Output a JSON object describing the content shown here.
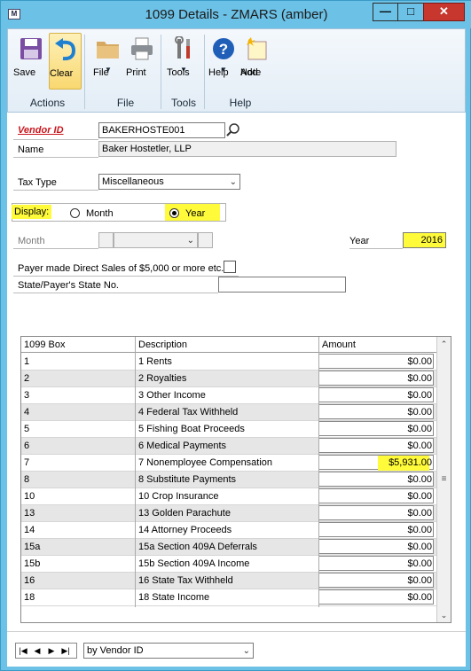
{
  "window": {
    "title": "1099 Details  -  ZMARS (amber)",
    "minimize": "—",
    "maximize": "□",
    "close": "✕"
  },
  "ribbon": {
    "groups": [
      {
        "name": "Actions",
        "items": [
          {
            "label": "Save",
            "icon": "save-icon"
          },
          {
            "label": "Clear",
            "icon": "undo-icon"
          }
        ]
      },
      {
        "name": "File",
        "items": [
          {
            "label": "File",
            "icon": "folder-icon"
          },
          {
            "label": "Print",
            "icon": "printer-icon"
          }
        ]
      },
      {
        "name": "Tools",
        "items": [
          {
            "label": "Tools",
            "icon": "tools-icon"
          }
        ]
      },
      {
        "name": "Help",
        "items": [
          {
            "label": "Help",
            "icon": "help-icon"
          },
          {
            "label": "Add\nNote",
            "icon": "note-icon"
          }
        ]
      }
    ],
    "save": "Save",
    "clear": "Clear",
    "file": "File",
    "print": "Print",
    "tools": "Tools",
    "help": "Help",
    "add": "Add",
    "note": "Note",
    "group_actions": "Actions",
    "group_file": "File",
    "group_tools": "Tools",
    "group_help": "Help"
  },
  "form": {
    "vendor_id_label": "Vendor ID",
    "vendor_id_value": "BAKERHOSTE001",
    "name_label": "Name",
    "name_value": "Baker Hostetler, LLP",
    "tax_type_label": "Tax Type",
    "tax_type_value": "Miscellaneous",
    "display_label": "Display:",
    "display_month": "Month",
    "display_year": "Year",
    "display_selected": "Year",
    "month_label": "Month",
    "year_label": "Year",
    "year_value": "2016",
    "direct_sales_label": "Payer made Direct Sales of $5,000 or more etc.",
    "direct_sales_checked": false,
    "state_label": "State/Payer's State No.",
    "state_value": ""
  },
  "grid": {
    "headers": [
      "1099 Box",
      "Description",
      "Amount"
    ],
    "rows": [
      {
        "box": "1",
        "description": "1 Rents",
        "amount": "$0.00"
      },
      {
        "box": "2",
        "description": "2 Royalties",
        "amount": "$0.00"
      },
      {
        "box": "3",
        "description": "3 Other Income",
        "amount": "$0.00"
      },
      {
        "box": "4",
        "description": "4 Federal Tax Withheld",
        "amount": "$0.00"
      },
      {
        "box": "5",
        "description": "5 Fishing Boat Proceeds",
        "amount": "$0.00"
      },
      {
        "box": "6",
        "description": "6 Medical Payments",
        "amount": "$0.00"
      },
      {
        "box": "7",
        "description": "7 Nonemployee Compensation",
        "amount": "$5,931.00"
      },
      {
        "box": "8",
        "description": "8 Substitute Payments",
        "amount": "$0.00"
      },
      {
        "box": "10",
        "description": "10 Crop Insurance",
        "amount": "$0.00"
      },
      {
        "box": "13",
        "description": "13 Golden Parachute",
        "amount": "$0.00"
      },
      {
        "box": "14",
        "description": "14 Attorney Proceeds",
        "amount": "$0.00"
      },
      {
        "box": "15a",
        "description": "15a Section 409A Deferrals",
        "amount": "$0.00"
      },
      {
        "box": "15b",
        "description": "15b Section 409A Income",
        "amount": "$0.00"
      },
      {
        "box": "16",
        "description": "16 State Tax Withheld",
        "amount": "$0.00"
      },
      {
        "box": "18",
        "description": "18 State Income",
        "amount": "$0.00"
      }
    ]
  },
  "bottom": {
    "sort_value": "by Vendor ID"
  },
  "colors": {
    "title_bar": "#6cc1e6",
    "highlight": "#fffb3a",
    "vendor_label": "#c8161d",
    "close_button": "#c7372e"
  }
}
